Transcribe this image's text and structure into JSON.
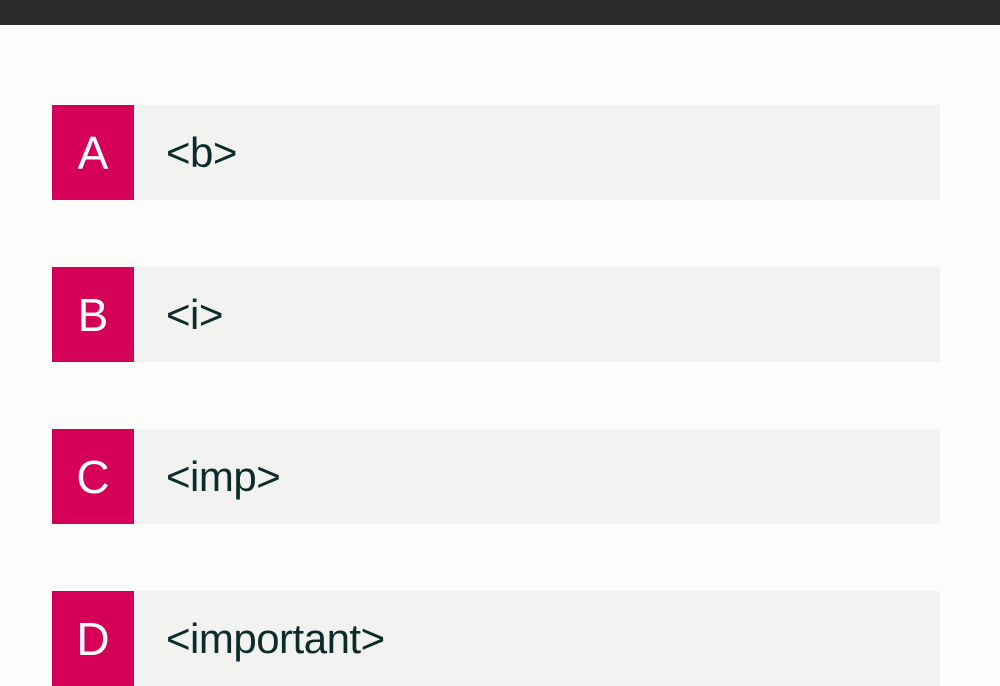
{
  "colors": {
    "accent": "#d50057",
    "bar": "#2b2b2b",
    "option_bg": "#f2f2f0",
    "text": "#0c2b2b"
  },
  "options": [
    {
      "letter": "A",
      "text": "<b>"
    },
    {
      "letter": "B",
      "text": "<i>"
    },
    {
      "letter": "C",
      "text": "<imp>"
    },
    {
      "letter": "D",
      "text": "<important>"
    }
  ]
}
